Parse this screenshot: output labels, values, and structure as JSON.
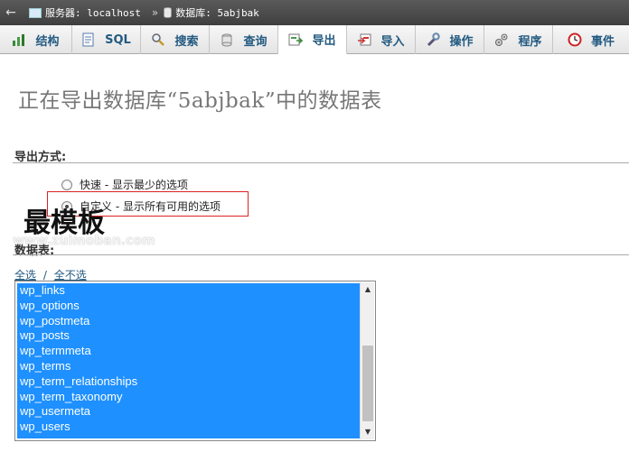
{
  "breadcrumb": {
    "server_label": "服务器: localhost",
    "database_label": "数据库: 5abjbak",
    "separator": "»"
  },
  "tabs": [
    {
      "label": "结构",
      "icon": "structure-icon"
    },
    {
      "label": "SQL",
      "icon": "sql-icon"
    },
    {
      "label": "搜索",
      "icon": "search-icon"
    },
    {
      "label": "查询",
      "icon": "query-icon"
    },
    {
      "label": "导出",
      "icon": "export-icon",
      "active": true
    },
    {
      "label": "导入",
      "icon": "import-icon"
    },
    {
      "label": "操作",
      "icon": "wrench-icon"
    },
    {
      "label": "程序",
      "icon": "routines-icon"
    },
    {
      "label": "事件",
      "icon": "events-icon"
    }
  ],
  "page_title": "正在导出数据库“5abjbak”中的数据表",
  "export_method": {
    "label": "导出方式:",
    "options": [
      {
        "label": "快速 - 显示最少的选项",
        "selected": false
      },
      {
        "label": "自定义 - 显示所有可用的选项",
        "selected": true
      }
    ]
  },
  "tables_section": {
    "label": "数据表:",
    "select_all": "全选",
    "divider": "/",
    "select_none": "全不选",
    "tables": [
      "wp_links",
      "wp_options",
      "wp_postmeta",
      "wp_posts",
      "wp_termmeta",
      "wp_terms",
      "wp_term_relationships",
      "wp_term_taxonomy",
      "wp_usermeta",
      "wp_users"
    ]
  },
  "watermark": {
    "text": "最模板",
    "url": "www.zuimoban.com"
  },
  "colors": {
    "topbar": "#4a4a4a",
    "selection": "#1e90ff",
    "highlight_border": "#dd2222",
    "link": "#235a81"
  }
}
